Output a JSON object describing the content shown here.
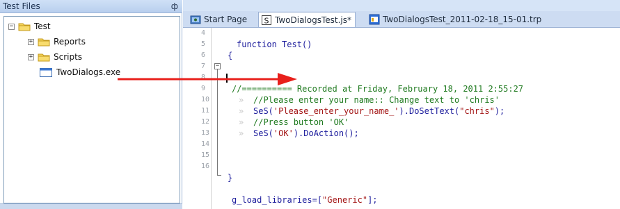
{
  "left_panel": {
    "title": "Test Files",
    "pin_glyph": "ф",
    "tree": [
      {
        "label": "Test",
        "expander": "−",
        "icon": "folder-icon"
      },
      {
        "label": "Reports",
        "expander": "+",
        "icon": "folder-icon"
      },
      {
        "label": "Scripts",
        "expander": "+",
        "icon": "folder-icon"
      },
      {
        "label": "TwoDialogs.exe",
        "icon": "exe-icon"
      }
    ]
  },
  "tabs": [
    {
      "label": "Start Page",
      "icon": "start-page-icon",
      "active": false
    },
    {
      "label": "TwoDialogsTest.js*",
      "icon": "script-icon",
      "active": true
    },
    {
      "label": "TwoDialogsTest_2011-02-18_15-01.trp",
      "icon": "trp-icon",
      "active": false
    }
  ],
  "editor": {
    "line_numbers": [
      "4",
      "5",
      "6",
      "7",
      "8",
      "9",
      "10",
      "11",
      "12",
      "13",
      "14",
      "15",
      "16"
    ],
    "lines": {
      "l5": "function Test()",
      "l6": "{",
      "l8": "//========== Recorded at Friday, February 18, 2011 2:55:27",
      "l9_dots": "»",
      "l9": "//Please enter your name:: Change text to 'chris'",
      "l10_dots": "»",
      "l10a": "SeS(",
      "l10b": "'Please_enter_your_name_'",
      "l10c": ").DoSetText(",
      "l10d": "\"chris\"",
      "l10e": ");",
      "l11_dots": "»",
      "l11": "//Press button 'OK'",
      "l12_dots": "»",
      "l12a": "SeS(",
      "l12b": "'OK'",
      "l12c": ").DoAction();",
      "l14": "}",
      "l16a": "g_load_libraries=[",
      "l16b": "\"Generic\"",
      "l16c": "];"
    },
    "fold_minus": "−"
  },
  "colors": {
    "arrow": "#e8201c",
    "keyword": "#1c1c9c",
    "comment": "#1f7a1f",
    "string": "#a31515"
  }
}
